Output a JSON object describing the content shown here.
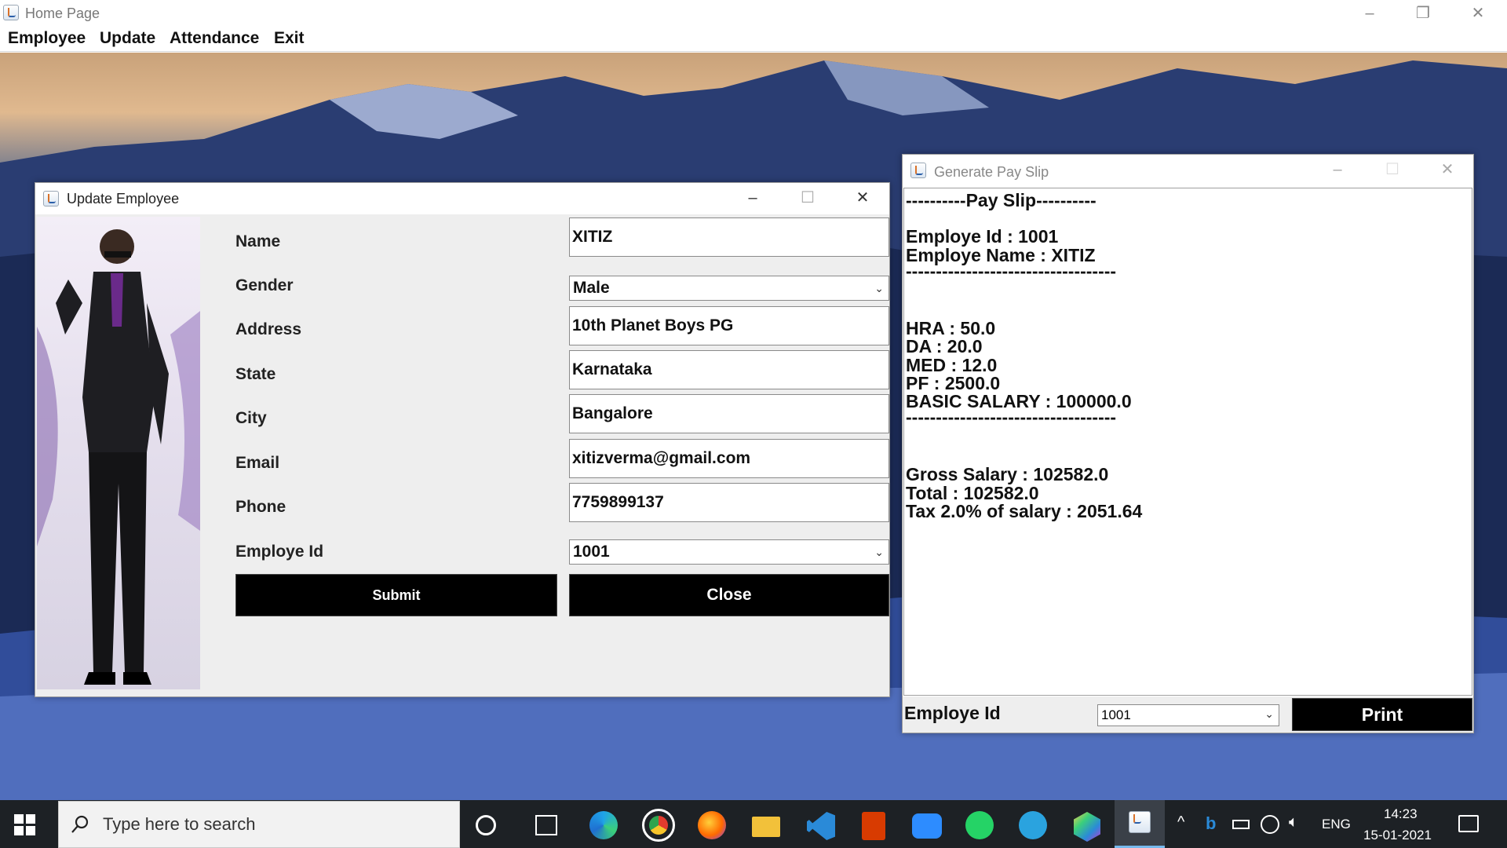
{
  "main_window": {
    "title": "Home Page",
    "menu": [
      "Employee",
      "Update",
      "Attendance",
      "Exit"
    ]
  },
  "update_employee": {
    "title": "Update Employee",
    "fields": [
      {
        "label": "Name",
        "value": "XITIZ"
      },
      {
        "label": "Gender",
        "value": "Male"
      },
      {
        "label": "Address",
        "value": "10th Planet Boys PG"
      },
      {
        "label": "State",
        "value": "Karnataka"
      },
      {
        "label": "City",
        "value": "Bangalore"
      },
      {
        "label": "Email",
        "value": "xitizverma@gmail.com"
      },
      {
        "label": "Phone",
        "value": "7759899137"
      },
      {
        "label": "Employe Id",
        "value": "1001"
      }
    ],
    "submit_label": "Submit",
    "close_label": "Close"
  },
  "pay_slip": {
    "title": "Generate Pay Slip",
    "lines": [
      "----------Pay Slip----------",
      "Employe Id : 1001",
      "Employe Name : XITIZ",
      "-----------------------------------",
      "HRA : 50.0",
      "DA : 20.0",
      "MED : 12.0",
      "PF : 2500.0",
      "BASIC SALARY : 100000.0",
      "-----------------------------------",
      "Gross Salary : 102582.0",
      "Total : 102582.0",
      "Tax 2.0% of salary : 2051.64"
    ],
    "employe_id_label": "Employe Id",
    "employe_id_value": "1001",
    "print_label": "Print"
  },
  "taskbar": {
    "search_placeholder": "Type here to search",
    "language": "ENG",
    "time": "14:23",
    "date": "15-01-2021"
  }
}
